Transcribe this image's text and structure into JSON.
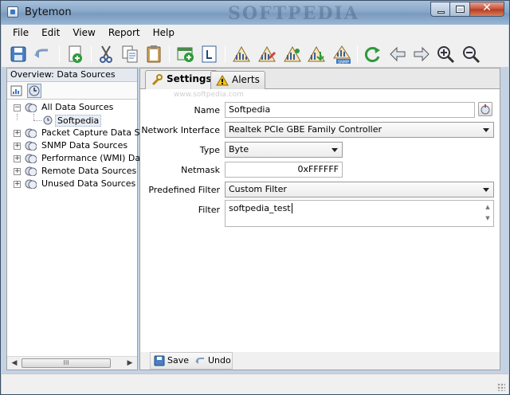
{
  "window": {
    "title": "Bytemon",
    "watermark": "SOFTPEDIA"
  },
  "menu": [
    "File",
    "Edit",
    "View",
    "Report",
    "Help"
  ],
  "left_panel": {
    "header": "Overview: Data Sources",
    "tree": [
      {
        "label": "All Data Sources",
        "expander": "−",
        "level": 0
      },
      {
        "label": "Softpedia",
        "level": 1,
        "selected": true
      },
      {
        "label": "Packet Capture Data Sou",
        "expander": "+",
        "level": 0
      },
      {
        "label": "SNMP Data Sources",
        "expander": "+",
        "level": 0
      },
      {
        "label": "Performance (WMI) Data",
        "expander": "+",
        "level": 0
      },
      {
        "label": "Remote Data Sources",
        "expander": "+",
        "level": 0
      },
      {
        "label": "Unused Data Sources",
        "expander": "+",
        "level": 0
      }
    ],
    "scroll_left": "◀",
    "scroll_grip": "III",
    "scroll_right": "▶"
  },
  "tabs": [
    {
      "label": "Settings",
      "icon": "wrench-icon",
      "active": true
    },
    {
      "label": "Alerts",
      "icon": "warning-icon",
      "active": false
    }
  ],
  "form": {
    "name_label": "Name",
    "name_value": "Softpedia",
    "interface_label": "Network Interface",
    "interface_value": "Realtek PCIe GBE Family Controller",
    "type_label": "Type",
    "type_value": "Byte",
    "netmask_label": "Netmask",
    "netmask_value": "0xFFFFFF",
    "predefined_label": "Predefined Filter",
    "predefined_value": "Custom Filter",
    "filter_label": "Filter",
    "filter_value": "softpedia_test",
    "url_watermark": "www.softpedia.com"
  },
  "actions": {
    "save": "Save",
    "undo": "Undo"
  },
  "colors": {
    "accent": "#3b78c4",
    "toolbar_green": "#2e9a3a",
    "titlebar": "#88a7c8"
  }
}
